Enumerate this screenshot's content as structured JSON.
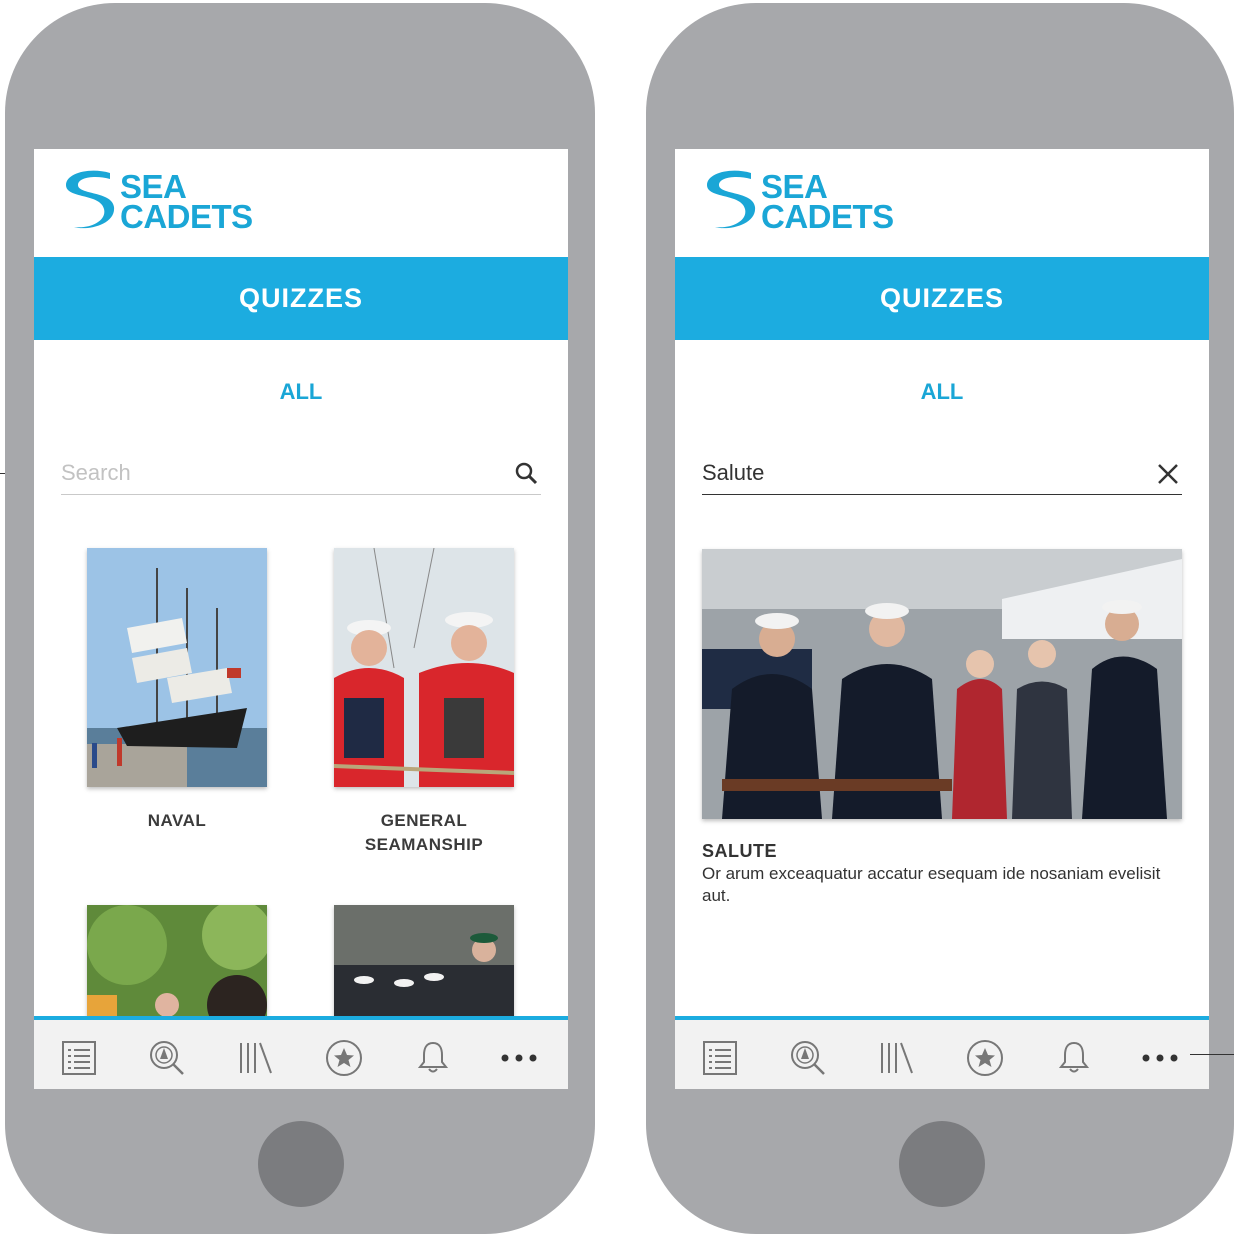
{
  "left_screen": {
    "logo": {
      "line1": "SEA",
      "line2": "CADETS"
    },
    "banner_title": "QUIZZES",
    "filter_label": "ALL",
    "search": {
      "placeholder": "Search"
    },
    "categories": [
      {
        "label": "NAVAL"
      },
      {
        "label": "GENERAL SEAMANSHIP"
      }
    ]
  },
  "right_screen": {
    "logo": {
      "line1": "SEA",
      "line2": "CADETS"
    },
    "banner_title": "QUIZZES",
    "filter_label": "ALL",
    "search": {
      "value": "Salute"
    },
    "result": {
      "title": "SALUTE",
      "description": "Or arum exceaquatur accatur esequam ide nosaniam evelisit aut."
    }
  },
  "tab_bar": {
    "icons": [
      "list-icon",
      "search-map-icon",
      "library-icon",
      "star-icon",
      "bell-icon",
      "more-icon"
    ]
  },
  "colors": {
    "brand_blue": "#1cace0",
    "phone_body": "#a7a8ab",
    "home_button": "#7b7c7f"
  }
}
